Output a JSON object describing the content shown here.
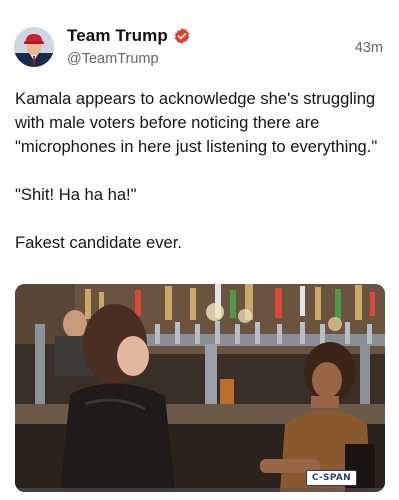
{
  "post": {
    "author": {
      "display_name": "Team Trump",
      "handle": "@TeamTrump",
      "verified": true,
      "verified_badge_color": "#e8392d",
      "avatar_icon": "profile-photo"
    },
    "timestamp": "43m",
    "paragraphs": [
      "Kamala appears to acknowledge she's struggling with male voters before noticing there are \"microphones in here just listening to everything.\"",
      "\"Shit! Ha ha ha!\"",
      "Fakest candidate ever."
    ],
    "media": {
      "type": "video-still",
      "watermark": "C-SPAN"
    }
  },
  "colors": {
    "text_primary": "#111111",
    "text_secondary": "#5f6670",
    "background": "#ffffff"
  }
}
